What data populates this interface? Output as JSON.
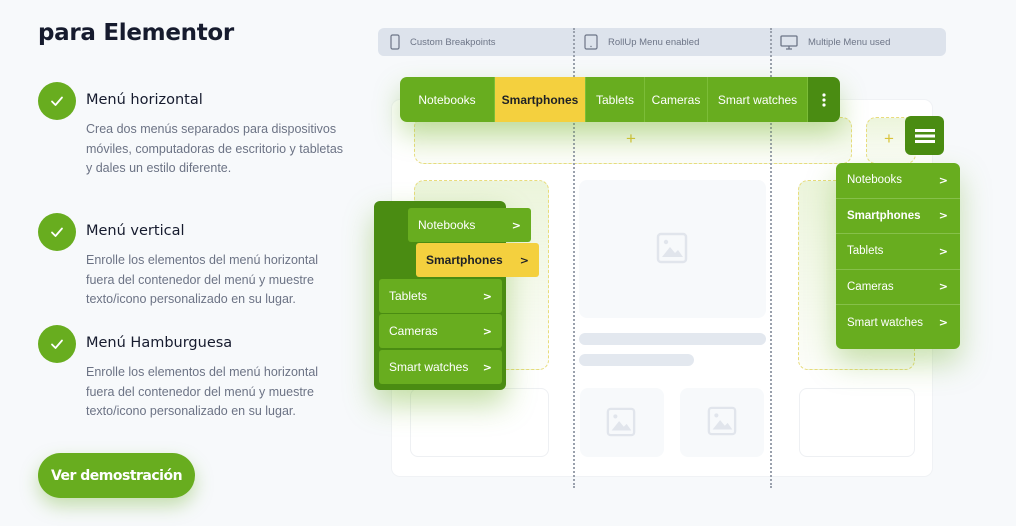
{
  "heading": "para Elementor",
  "features": [
    {
      "title": "Menú horizontal",
      "description": "Crea dos menús separados para dispositivos móviles, computadoras de escritorio y tabletas y dales un estilo diferente.",
      "icon": "check-icon"
    },
    {
      "title": "Menú vertical",
      "description": "Enrolle los elementos del menú horizontal fuera del contenedor del menú y muestre texto/icono personalizado en su lugar.",
      "icon": "check-icon"
    },
    {
      "title": "Menú Hamburguesa",
      "description": "Enrolle los elementos del menú horizontal fuera del contenedor del menú y muestre texto/icono personalizado en su lugar.",
      "icon": "check-icon"
    }
  ],
  "cta": {
    "label": "Ver demostración"
  },
  "breakpoints": [
    {
      "label": "Custom Breakpoints",
      "icon": "mobile-icon"
    },
    {
      "label": "RollUp Menu enabled",
      "icon": "tablet-icon"
    },
    {
      "label": "Multiple Menu used",
      "icon": "desktop-icon"
    }
  ],
  "horizontal_menu": {
    "items": [
      "Notebooks",
      "Smartphones",
      "Tablets",
      "Cameras",
      "Smart watches"
    ],
    "active": "Smartphones",
    "more_icon": "kebab-icon"
  },
  "vertical_menu": {
    "items": [
      "Notebooks",
      "Smartphones",
      "Tablets",
      "Cameras",
      "Smart watches"
    ],
    "active": "Smartphones"
  },
  "dropdown_menu": {
    "items": [
      "Notebooks",
      "Smartphones",
      "Tablets",
      "Cameras",
      "Smart watches"
    ],
    "active": "Smartphones",
    "toggle_icon": "hamburger-icon"
  },
  "plus_symbol": "+",
  "chevron": ">",
  "colors": {
    "brand_green": "#68ad1f",
    "dark_green": "#4a8c12",
    "highlight_yellow": "#f4d03e",
    "heading": "#161b2e",
    "body_text": "#6c7385"
  }
}
